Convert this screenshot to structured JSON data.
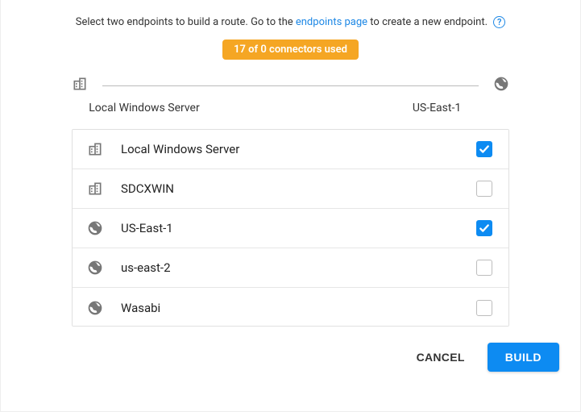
{
  "intro": {
    "pre": "Select two endpoints to build a route. Go to the ",
    "link": "endpoints page",
    "post": " to create a new endpoint."
  },
  "badge": "17 of 0 connectors used",
  "route": {
    "left_label": "Local Windows Server",
    "right_label": "US-East-1",
    "left_icon": "building",
    "right_icon": "globe"
  },
  "endpoints": [
    {
      "icon": "building",
      "name": "Local Windows Server",
      "checked": true
    },
    {
      "icon": "building",
      "name": "SDCXWIN",
      "checked": false
    },
    {
      "icon": "globe",
      "name": "US-East-1",
      "checked": true
    },
    {
      "icon": "globe",
      "name": "us-east-2",
      "checked": false
    },
    {
      "icon": "globe",
      "name": "Wasabi",
      "checked": false
    }
  ],
  "actions": {
    "cancel": "CANCEL",
    "build": "BUILD"
  }
}
